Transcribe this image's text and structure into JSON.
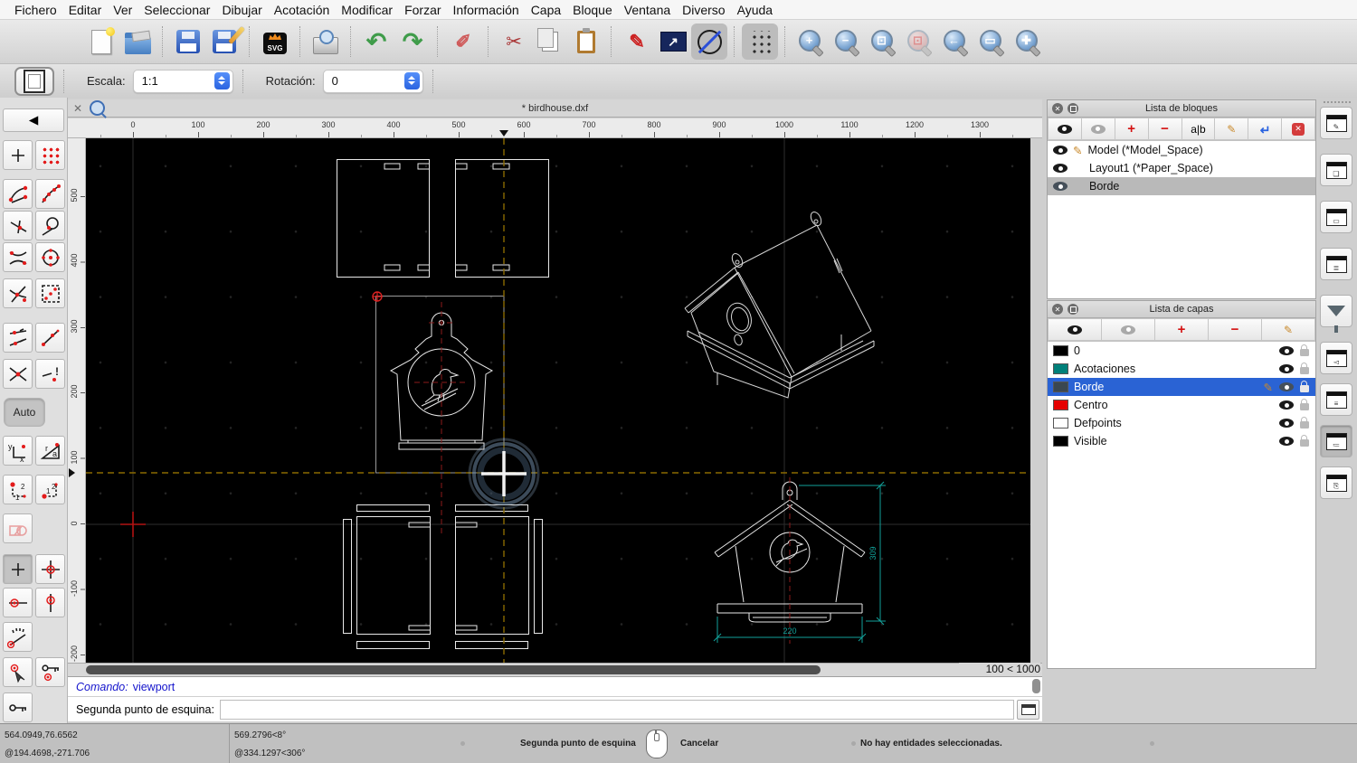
{
  "menu": {
    "items": [
      "Fichero",
      "Editar",
      "Ver",
      "Seleccionar",
      "Dibujar",
      "Acotación",
      "Modificar",
      "Forzar",
      "Información",
      "Capa",
      "Bloque",
      "Ventana",
      "Diverso",
      "Ayuda"
    ]
  },
  "options": {
    "scale_label": "Escala:",
    "scale_value": "1:1",
    "rotation_label": "Rotación:",
    "rotation_value": "0"
  },
  "doc": {
    "tab_title": "* birdhouse.dxf",
    "close": "✕"
  },
  "ruler": {
    "h": [
      "0",
      "100",
      "200",
      "300",
      "400",
      "500",
      "600",
      "700",
      "800",
      "900",
      "1000",
      "1100",
      "1200",
      "1300"
    ],
    "v": [
      "500",
      "400",
      "300",
      "200",
      "100",
      "0",
      "-100",
      "-200"
    ]
  },
  "canvas": {
    "grid_status": "100 < 1000",
    "dim_height": "309",
    "dim_width": "220",
    "colors": {
      "construction": "#8a6a00",
      "centerline": "#8b1a1a",
      "dimension": "#12a19a",
      "origin": "#cc1111",
      "entity": "#e8e8e8",
      "selection_rect": "#9a9a9a"
    }
  },
  "blocks": {
    "title": "Lista de bloques",
    "rename_button": "a|b",
    "items": [
      {
        "name": "Model (*Model_Space)"
      },
      {
        "name": "Layout1 (*Paper_Space)"
      },
      {
        "name": "Borde"
      }
    ]
  },
  "layers": {
    "title": "Lista de capas",
    "selected": "Borde",
    "rows": [
      {
        "name": "0",
        "color": "#000000"
      },
      {
        "name": "Acotaciones",
        "color": "#00807a"
      },
      {
        "name": "Borde",
        "color": "#3a4750"
      },
      {
        "name": "Centro",
        "color": "#e60000"
      },
      {
        "name": "Defpoints",
        "color": "#ffffff"
      },
      {
        "name": "Visible",
        "color": "#000000"
      }
    ]
  },
  "command": {
    "prompt_label": "Comando:",
    "last_command": "viewport",
    "input_label": "Segunda punto de esquina:",
    "input_value": ""
  },
  "status": {
    "abs_cartesian": "564.0949,76.6562",
    "rel_cartesian": "@194.4698,-271.706",
    "abs_polar": "569.2796<8°",
    "rel_polar": "@334.1297<306°",
    "hint": "Segunda punto de esquina",
    "cancel_label": "Cancelar",
    "selection_info": "No hay entidades seleccionadas.",
    "accent": "#2a63e0"
  },
  "icons": {
    "back": "◀",
    "auto": "Auto",
    "svg": "SVG",
    "close": "✕",
    "zoom_in": "+",
    "zoom_out": "−",
    "zoom_auto": "⊡",
    "zoom_selection": "⊡",
    "zoom_previous": "←",
    "zoom_window": "▭",
    "zoom_pan": "✚",
    "undo": "↶",
    "redo": "↷",
    "erase": "✐",
    "cut": "✂",
    "pencil": "✎",
    "arrow_ne": "↗",
    "x": "x",
    "y": "y",
    "r": "r",
    "a": "a",
    "excl": "!",
    "plus": "+",
    "minus": "−",
    "delete_all": "✕",
    "insert": "↴"
  }
}
